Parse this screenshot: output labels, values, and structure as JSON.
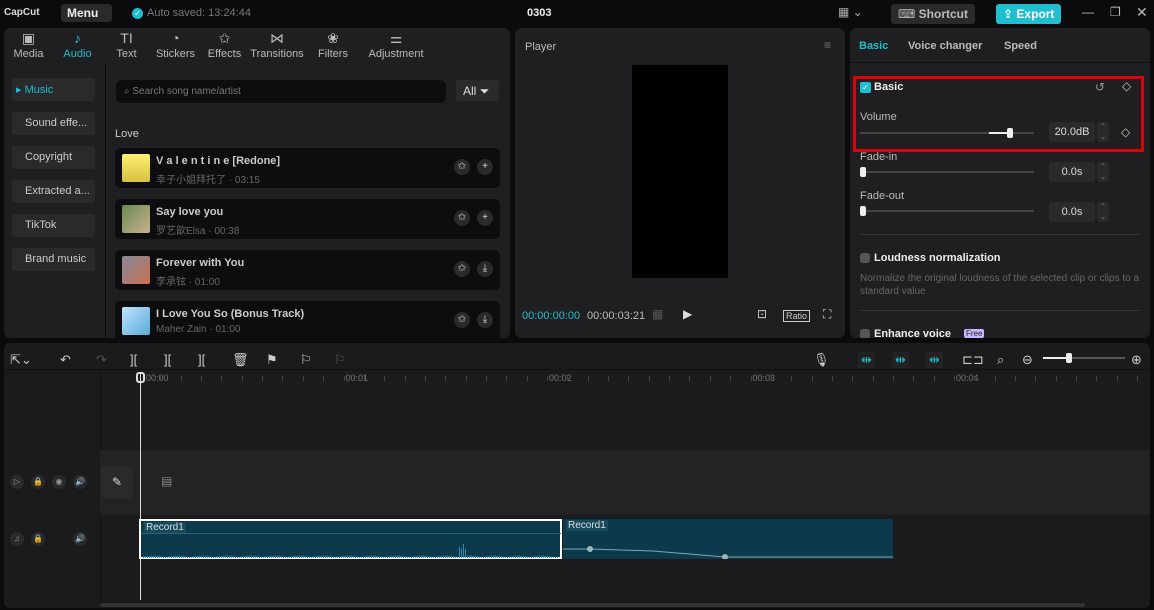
{
  "app": {
    "logo": "CapCut",
    "menu": "Menu",
    "autosave": "Auto saved: 13:24:44",
    "project_title": "0303",
    "shortcut": "Shortcut",
    "export": "Export",
    "accent": "#1fbfcf"
  },
  "tabs": [
    {
      "label": "Media",
      "icon": "media-icon"
    },
    {
      "label": "Audio",
      "icon": "music-note-icon",
      "active": true
    },
    {
      "label": "Text",
      "icon": "text-icon"
    },
    {
      "label": "Stickers",
      "icon": "sticker-icon"
    },
    {
      "label": "Effects",
      "icon": "star-icon"
    },
    {
      "label": "Transitions",
      "icon": "bowtie-icon"
    },
    {
      "label": "Filters",
      "icon": "filters-icon"
    },
    {
      "label": "Adjustment",
      "icon": "sliders-icon"
    }
  ],
  "audio_nav": [
    "Music",
    "Sound effe...",
    "Copyright",
    "Extracted a...",
    "TikTok",
    "Brand music"
  ],
  "search": {
    "placeholder": "Search song name/artist",
    "filter": "All"
  },
  "section": "Love",
  "songs": [
    {
      "title": "V a l e n t i n e [Redone]",
      "meta": "幸子小姐拜托了 · 03:15",
      "action": "add"
    },
    {
      "title": "Say love you",
      "meta": "罗艺歆Elsa · 00:38",
      "action": "add"
    },
    {
      "title": "Forever with You",
      "meta": "李承铉 · 01:00",
      "action": "download"
    },
    {
      "title": "I Love You So (Bonus Track)",
      "meta": "Maher Zain · 01:00",
      "action": "download"
    }
  ],
  "player": {
    "title": "Player",
    "current": "00:00:00:00",
    "total": "00:00:03:21",
    "ratio": "Ratio"
  },
  "inspector": {
    "tabs": [
      "Basic",
      "Voice changer",
      "Speed"
    ],
    "basic": "Basic",
    "volume_label": "Volume",
    "volume": "20.0dB",
    "volume_level": 0.86,
    "fadein_label": "Fade-in",
    "fadein": "0.0s",
    "fadeout_label": "Fade-out",
    "fadeout": "0.0s",
    "loudness": "Loudness normalization",
    "loudness_desc": "Normalize the original loudness of the selected clip or clips to a standard value",
    "enhance": "Enhance voice",
    "free": "Free"
  },
  "timeline": {
    "ruler": [
      "00:00",
      "00:01",
      "00:02",
      "00:03",
      "00:04"
    ],
    "clips": [
      "Record1",
      "Record1"
    ],
    "zoom_level": 0.32
  }
}
